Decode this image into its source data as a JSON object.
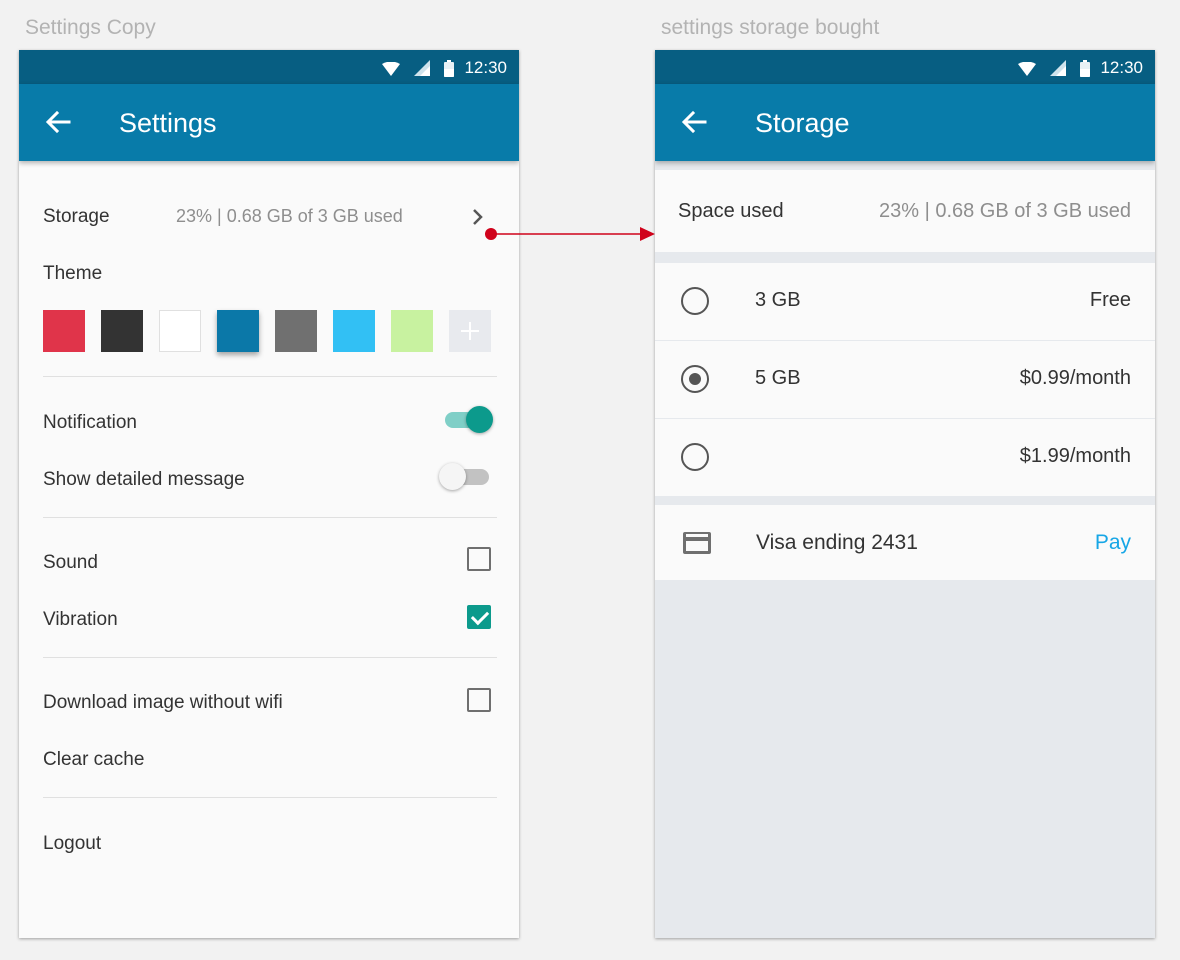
{
  "artboards": {
    "left_title": "Settings Copy",
    "right_title": "settings storage bought"
  },
  "statusbar": {
    "time": "12:30"
  },
  "settings": {
    "title": "Settings",
    "storage": {
      "label": "Storage",
      "value": "23%  |  0.68 GB of 3 GB used"
    },
    "theme": {
      "label": "Theme",
      "swatches": [
        "#e0344a",
        "#333333",
        "#ffffff",
        "#0b78a8",
        "#707070",
        "#32c0f4",
        "#c8f2a0"
      ],
      "selected_index": 3
    },
    "notification": {
      "label": "Notification",
      "on": true
    },
    "detailed_message": {
      "label": "Show detailed message",
      "on": false
    },
    "sound": {
      "label": "Sound",
      "checked": false
    },
    "vibration": {
      "label": "Vibration",
      "checked": true
    },
    "download_without_wifi": {
      "label": "Download image without wifi",
      "checked": false
    },
    "clear_cache": "Clear cache",
    "logout": "Logout"
  },
  "storage": {
    "title": "Storage",
    "space_used_label": "Space used",
    "space_used_value": "23%  |  0.68 GB of 3 GB used",
    "plans": [
      {
        "size": "3 GB",
        "price": "Free",
        "selected": false
      },
      {
        "size": "5 GB",
        "price": "$0.99/month",
        "selected": true
      },
      {
        "size": "",
        "price": "$1.99/month",
        "selected": false
      }
    ],
    "payment_method": "Visa ending 2431",
    "pay_label": "Pay"
  },
  "colors": {
    "statusbar": "#075e82",
    "appbar": "#087ba9",
    "accent": "#0c9a8c",
    "link": "#16a6e6",
    "connector": "#d0021b"
  }
}
